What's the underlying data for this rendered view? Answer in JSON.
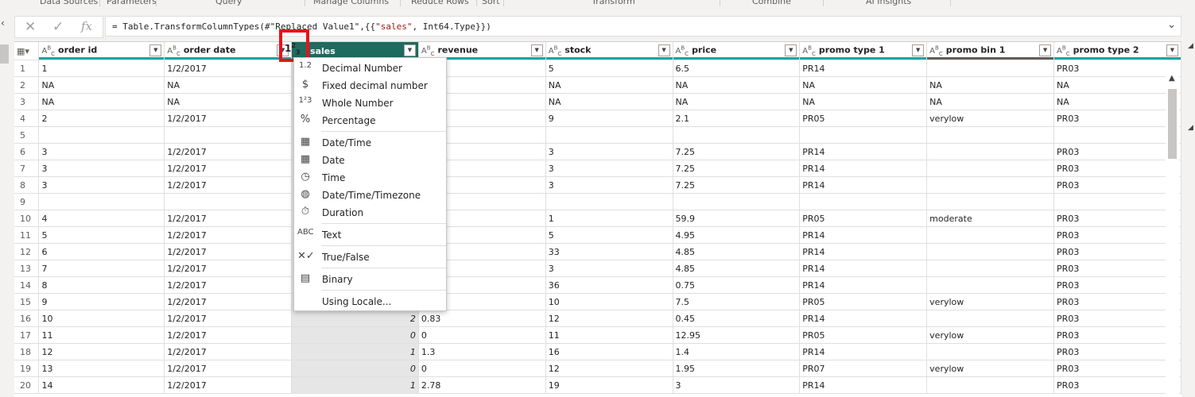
{
  "ribbon": {
    "groups": [
      "Data Sources",
      "Parameters",
      "Query",
      "Manage Columns",
      "Reduce Rows",
      "Sort",
      "Transform",
      "Combine",
      "AI Insights"
    ]
  },
  "formula_bar": {
    "cancel_icon": "close-icon",
    "commit_icon": "check-icon",
    "fx_label": "fx",
    "formula_prefix": "= Table.TransformColumnTypes(#\"Replaced Value1\",{{",
    "formula_string": "\"sales\"",
    "formula_suffix": ", Int64.Type}})",
    "expand_icon": "chevron-down-icon"
  },
  "grid": {
    "columns": [
      {
        "name": "order id",
        "type_icon": "ABC"
      },
      {
        "name": "order date",
        "type_icon": "ABC"
      },
      {
        "name": "sales",
        "type_icon": "123"
      },
      {
        "name": "revenue",
        "type_icon": "ABC"
      },
      {
        "name": "stock",
        "type_icon": "ABC"
      },
      {
        "name": "price",
        "type_icon": "ABC"
      },
      {
        "name": "promo type 1",
        "type_icon": "ABC"
      },
      {
        "name": "promo bin 1",
        "type_icon": "ABC"
      },
      {
        "name": "promo type 2",
        "type_icon": "ABC"
      }
    ],
    "rows": [
      [
        "1",
        "1",
        "1/2/2017",
        "",
        "",
        "5",
        "6.5",
        "PR14",
        "",
        "PR03"
      ],
      [
        "2",
        "NA",
        "NA",
        "",
        "",
        "NA",
        "NA",
        "NA",
        "NA",
        "NA"
      ],
      [
        "3",
        "NA",
        "NA",
        "",
        "",
        "NA",
        "NA",
        "NA",
        "NA",
        "NA"
      ],
      [
        "4",
        "2",
        "1/2/2017",
        "",
        "",
        "9",
        "2.1",
        "PR05",
        "verylow",
        "PR03"
      ],
      [
        "5",
        "",
        "",
        "",
        "",
        "",
        "",
        "",
        "",
        ""
      ],
      [
        "6",
        "3",
        "1/2/2017",
        "",
        "",
        "3",
        "7.25",
        "PR14",
        "",
        "PR03"
      ],
      [
        "7",
        "3",
        "1/2/2017",
        "",
        "",
        "3",
        "7.25",
        "PR14",
        "",
        "PR03"
      ],
      [
        "8",
        "3",
        "1/2/2017",
        "",
        "",
        "3",
        "7.25",
        "PR14",
        "",
        "PR03"
      ],
      [
        "9",
        "",
        "",
        "",
        "",
        "",
        "",
        "",
        "",
        ""
      ],
      [
        "10",
        "4",
        "1/2/2017",
        "",
        "",
        "1",
        "59.9",
        "PR05",
        "moderate",
        "PR03"
      ],
      [
        "11",
        "5",
        "1/2/2017",
        "",
        "",
        "5",
        "4.95",
        "PR14",
        "",
        "PR03"
      ],
      [
        "12",
        "6",
        "1/2/2017",
        "",
        "",
        "33",
        "4.85",
        "PR14",
        "",
        "PR03"
      ],
      [
        "13",
        "7",
        "1/2/2017",
        "",
        "",
        "3",
        "4.85",
        "PR14",
        "",
        "PR03"
      ],
      [
        "14",
        "8",
        "1/2/2017",
        "",
        "",
        "36",
        "0.75",
        "PR14",
        "",
        "PR03"
      ],
      [
        "15",
        "9",
        "1/2/2017",
        "",
        "",
        "10",
        "7.5",
        "PR05",
        "verylow",
        "PR03"
      ],
      [
        "16",
        "10",
        "1/2/2017",
        "2",
        "0.83",
        "12",
        "0.45",
        "PR14",
        "",
        "PR03"
      ],
      [
        "17",
        "11",
        "1/2/2017",
        "0",
        "0",
        "11",
        "12.95",
        "PR05",
        "verylow",
        "PR03"
      ],
      [
        "18",
        "12",
        "1/2/2017",
        "1",
        "1.3",
        "16",
        "1.4",
        "PR14",
        "",
        "PR03"
      ],
      [
        "19",
        "13",
        "1/2/2017",
        "0",
        "0",
        "12",
        "1.95",
        "PR07",
        "verylow",
        "PR03"
      ],
      [
        "20",
        "14",
        "1/2/2017",
        "1",
        "2.78",
        "19",
        "3",
        "PR14",
        "",
        "PR03"
      ]
    ]
  },
  "type_menu": {
    "items": [
      {
        "icon": "1.2",
        "label": "Decimal Number"
      },
      {
        "icon": "$",
        "label": "Fixed decimal number"
      },
      {
        "icon": "1²3",
        "label": "Whole Number"
      },
      {
        "icon": "%",
        "label": "Percentage"
      },
      {
        "icon": "▦",
        "label": "Date/Time"
      },
      {
        "icon": "▦",
        "label": "Date"
      },
      {
        "icon": "◷",
        "label": "Time"
      },
      {
        "icon": "◍",
        "label": "Date/Time/Timezone"
      },
      {
        "icon": "⏱",
        "label": "Duration"
      },
      {
        "icon": "ABC",
        "label": "Text"
      },
      {
        "icon": "✕✓",
        "label": "True/False"
      },
      {
        "icon": "▤",
        "label": "Binary"
      },
      {
        "icon": "",
        "label": "Using Locale..."
      }
    ]
  },
  "colors": {
    "selected_column_header": "#1e6b5f",
    "quality_bar": "#18a5a0",
    "highlight_box": "#e8121a"
  }
}
